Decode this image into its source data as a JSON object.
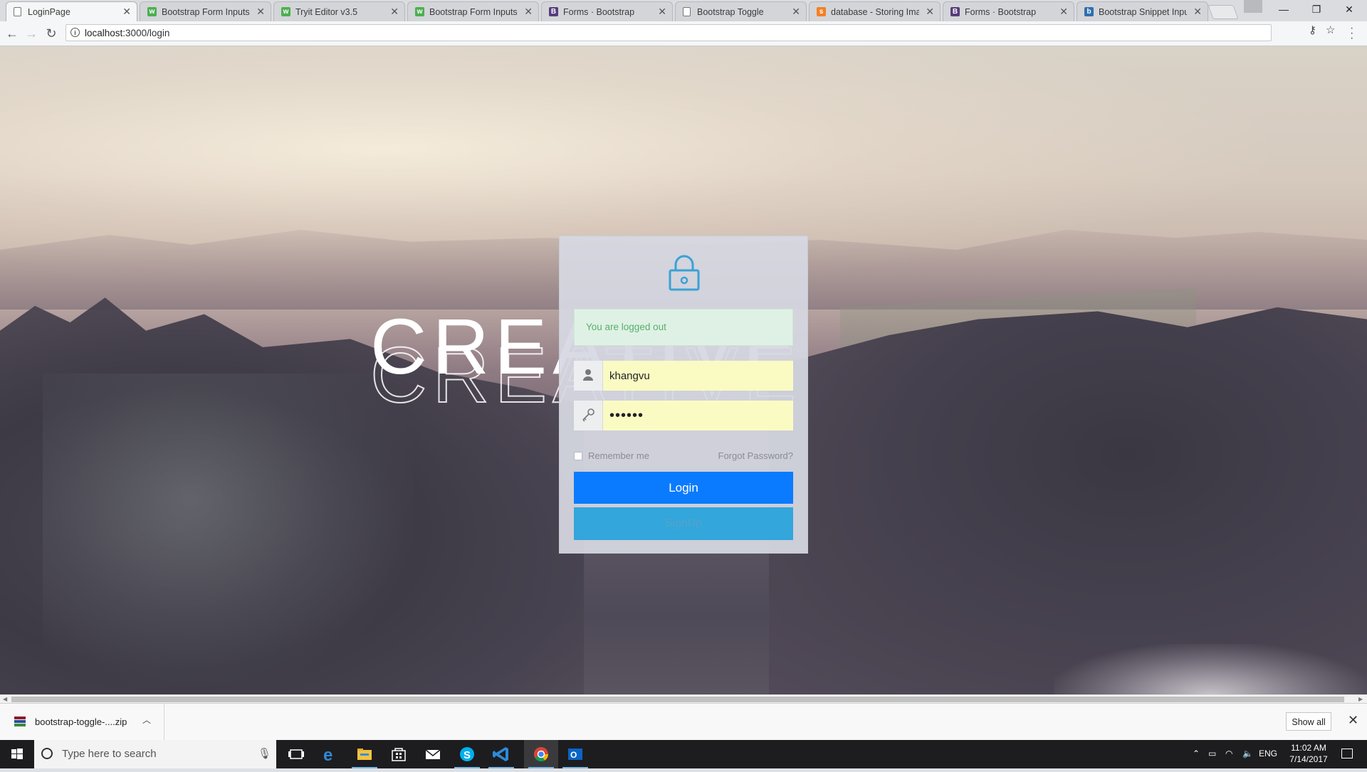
{
  "browser": {
    "tabs": [
      {
        "title": "LoginPage",
        "favicon": "page-icon",
        "active": true
      },
      {
        "title": "Bootstrap Form Inputs (",
        "favicon": "w3schools-icon"
      },
      {
        "title": "Tryit Editor v3.5",
        "favicon": "w3schools-icon"
      },
      {
        "title": "Bootstrap Form Inputs (",
        "favicon": "w3schools-icon"
      },
      {
        "title": "Forms · Bootstrap",
        "favicon": "bootstrap-icon"
      },
      {
        "title": "Bootstrap Toggle",
        "favicon": "page-icon"
      },
      {
        "title": "database - Storing Imag",
        "favicon": "stackoverflow-icon"
      },
      {
        "title": "Forms · Bootstrap",
        "favicon": "bootstrap-icon"
      },
      {
        "title": "Bootstrap Snippet Input",
        "favicon": "bootsnipp-icon"
      }
    ],
    "address": {
      "host": "localhost",
      "path": ":3000/login"
    },
    "window_controls": [
      "minimize",
      "restore",
      "close"
    ]
  },
  "background": {
    "word": "CREATIVE"
  },
  "login": {
    "alert": "You are logged out",
    "username_value": "khangvu",
    "password_mask": "••••••",
    "remember_label": "Remember me",
    "forgot_label": "Forgot Password?",
    "login_label": "Login",
    "signup_label": "SignUp"
  },
  "downloads": {
    "file": "bootstrap-toggle-....zip",
    "show_all": "Show all"
  },
  "taskbar": {
    "search_placeholder": "Type here to search",
    "apps": [
      "task-view-icon",
      "edge-icon",
      "file-explorer-icon",
      "store-icon",
      "mail-icon",
      "skype-icon",
      "vscode-icon",
      "chrome-icon",
      "outlook-icon"
    ],
    "language": "ENG",
    "time": "11:02 AM",
    "date": "7/14/2017"
  },
  "colors": {
    "accent_login": "#0a7bff",
    "signup": "#33a6dc",
    "alert_bg": "#dff1e4",
    "alert_text": "#56b06b",
    "autofill_bg": "#fafbc3",
    "lock_icon": "#3aa2d6"
  }
}
